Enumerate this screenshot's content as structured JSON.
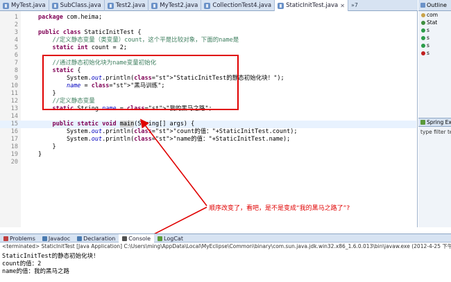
{
  "editor_tabs": [
    {
      "label": "MyTest.java",
      "active": false
    },
    {
      "label": "SubClass.java",
      "active": false
    },
    {
      "label": "Test2.java",
      "active": false
    },
    {
      "label": "MyTest2.java",
      "active": false
    },
    {
      "label": "CollectionTest4.java",
      "active": false
    },
    {
      "label": "StaticInitTest.java",
      "active": true
    }
  ],
  "tab_overflow": "»7",
  "code_lines": [
    {
      "n": "1",
      "text": "package com.heima;"
    },
    {
      "n": "2",
      "text": ""
    },
    {
      "n": "3",
      "text": "public class StaticInitTest {"
    },
    {
      "n": "4",
      "text": "    //定义静态变量（类变量）count，这个平是比较对象，下面的name是"
    },
    {
      "n": "5",
      "text": "    static int count = 2;"
    },
    {
      "n": "6",
      "text": ""
    },
    {
      "n": "7",
      "text": "    //通过静态初始化块为name变量初始化"
    },
    {
      "n": "8",
      "text": "    static {"
    },
    {
      "n": "9",
      "text": "        System.out.println(\"StaticInitTest的静态初始化块！\");"
    },
    {
      "n": "10",
      "text": "        name = \"黑马训练\";"
    },
    {
      "n": "11",
      "text": "    }"
    },
    {
      "n": "12",
      "text": "    //定义静态变量"
    },
    {
      "n": "13",
      "text": "    static String name = \"我的黑马之路\";"
    },
    {
      "n": "14",
      "text": ""
    },
    {
      "n": "15",
      "text": "    public static void main(String[] args) {"
    },
    {
      "n": "16",
      "text": "        System.out.println(\"count的值：\"+StaticInitTest.count);"
    },
    {
      "n": "17",
      "text": "        System.out.println(\"name的值：\"+StaticInitTest.name);"
    },
    {
      "n": "18",
      "text": "    }"
    },
    {
      "n": "19",
      "text": "}"
    },
    {
      "n": "20",
      "text": ""
    }
  ],
  "annotation": "顺序改变了，看吧，是不是变成“我的黑马之路了”?",
  "outline": {
    "tab_label": "Outline",
    "items": [
      {
        "label": "com",
        "color": "#c9a34a"
      },
      {
        "label": "Stat",
        "color": "#3f8f3f"
      },
      {
        "label": "s",
        "color": "#2c9c4a"
      },
      {
        "label": "s",
        "color": "#2c9c4a"
      },
      {
        "label": "s",
        "color": "#2c9c4a"
      },
      {
        "label": "s",
        "color": "#c02020"
      }
    ]
  },
  "spring": {
    "tab_label": "Spring Ex",
    "filter_text": "type filter tex"
  },
  "bottom_tabs": [
    {
      "label": "Problems",
      "active": false,
      "color": "#c04040"
    },
    {
      "label": "Javadoc",
      "active": false,
      "color": "#4a7ab0"
    },
    {
      "label": "Declaration",
      "active": false,
      "color": "#4a7ab0"
    },
    {
      "label": "Console",
      "active": true,
      "color": "#505050"
    },
    {
      "label": "LogCat",
      "active": false,
      "color": "#5a9a3a"
    }
  ],
  "console": {
    "header": "<terminated> StaticInitTest [Java Application] C:\\Users\\ming\\AppData\\Local\\MyEclipse\\Common\\binary\\com.sun.java.jdk.win32.x86_1.6.0.013\\bin\\javaw.exe (2012-4-25 下午5:20:00)",
    "lines": [
      "StaticInitTest的静态初始化块！",
      "count的值：2",
      "name的值：我的黑马之路"
    ]
  }
}
